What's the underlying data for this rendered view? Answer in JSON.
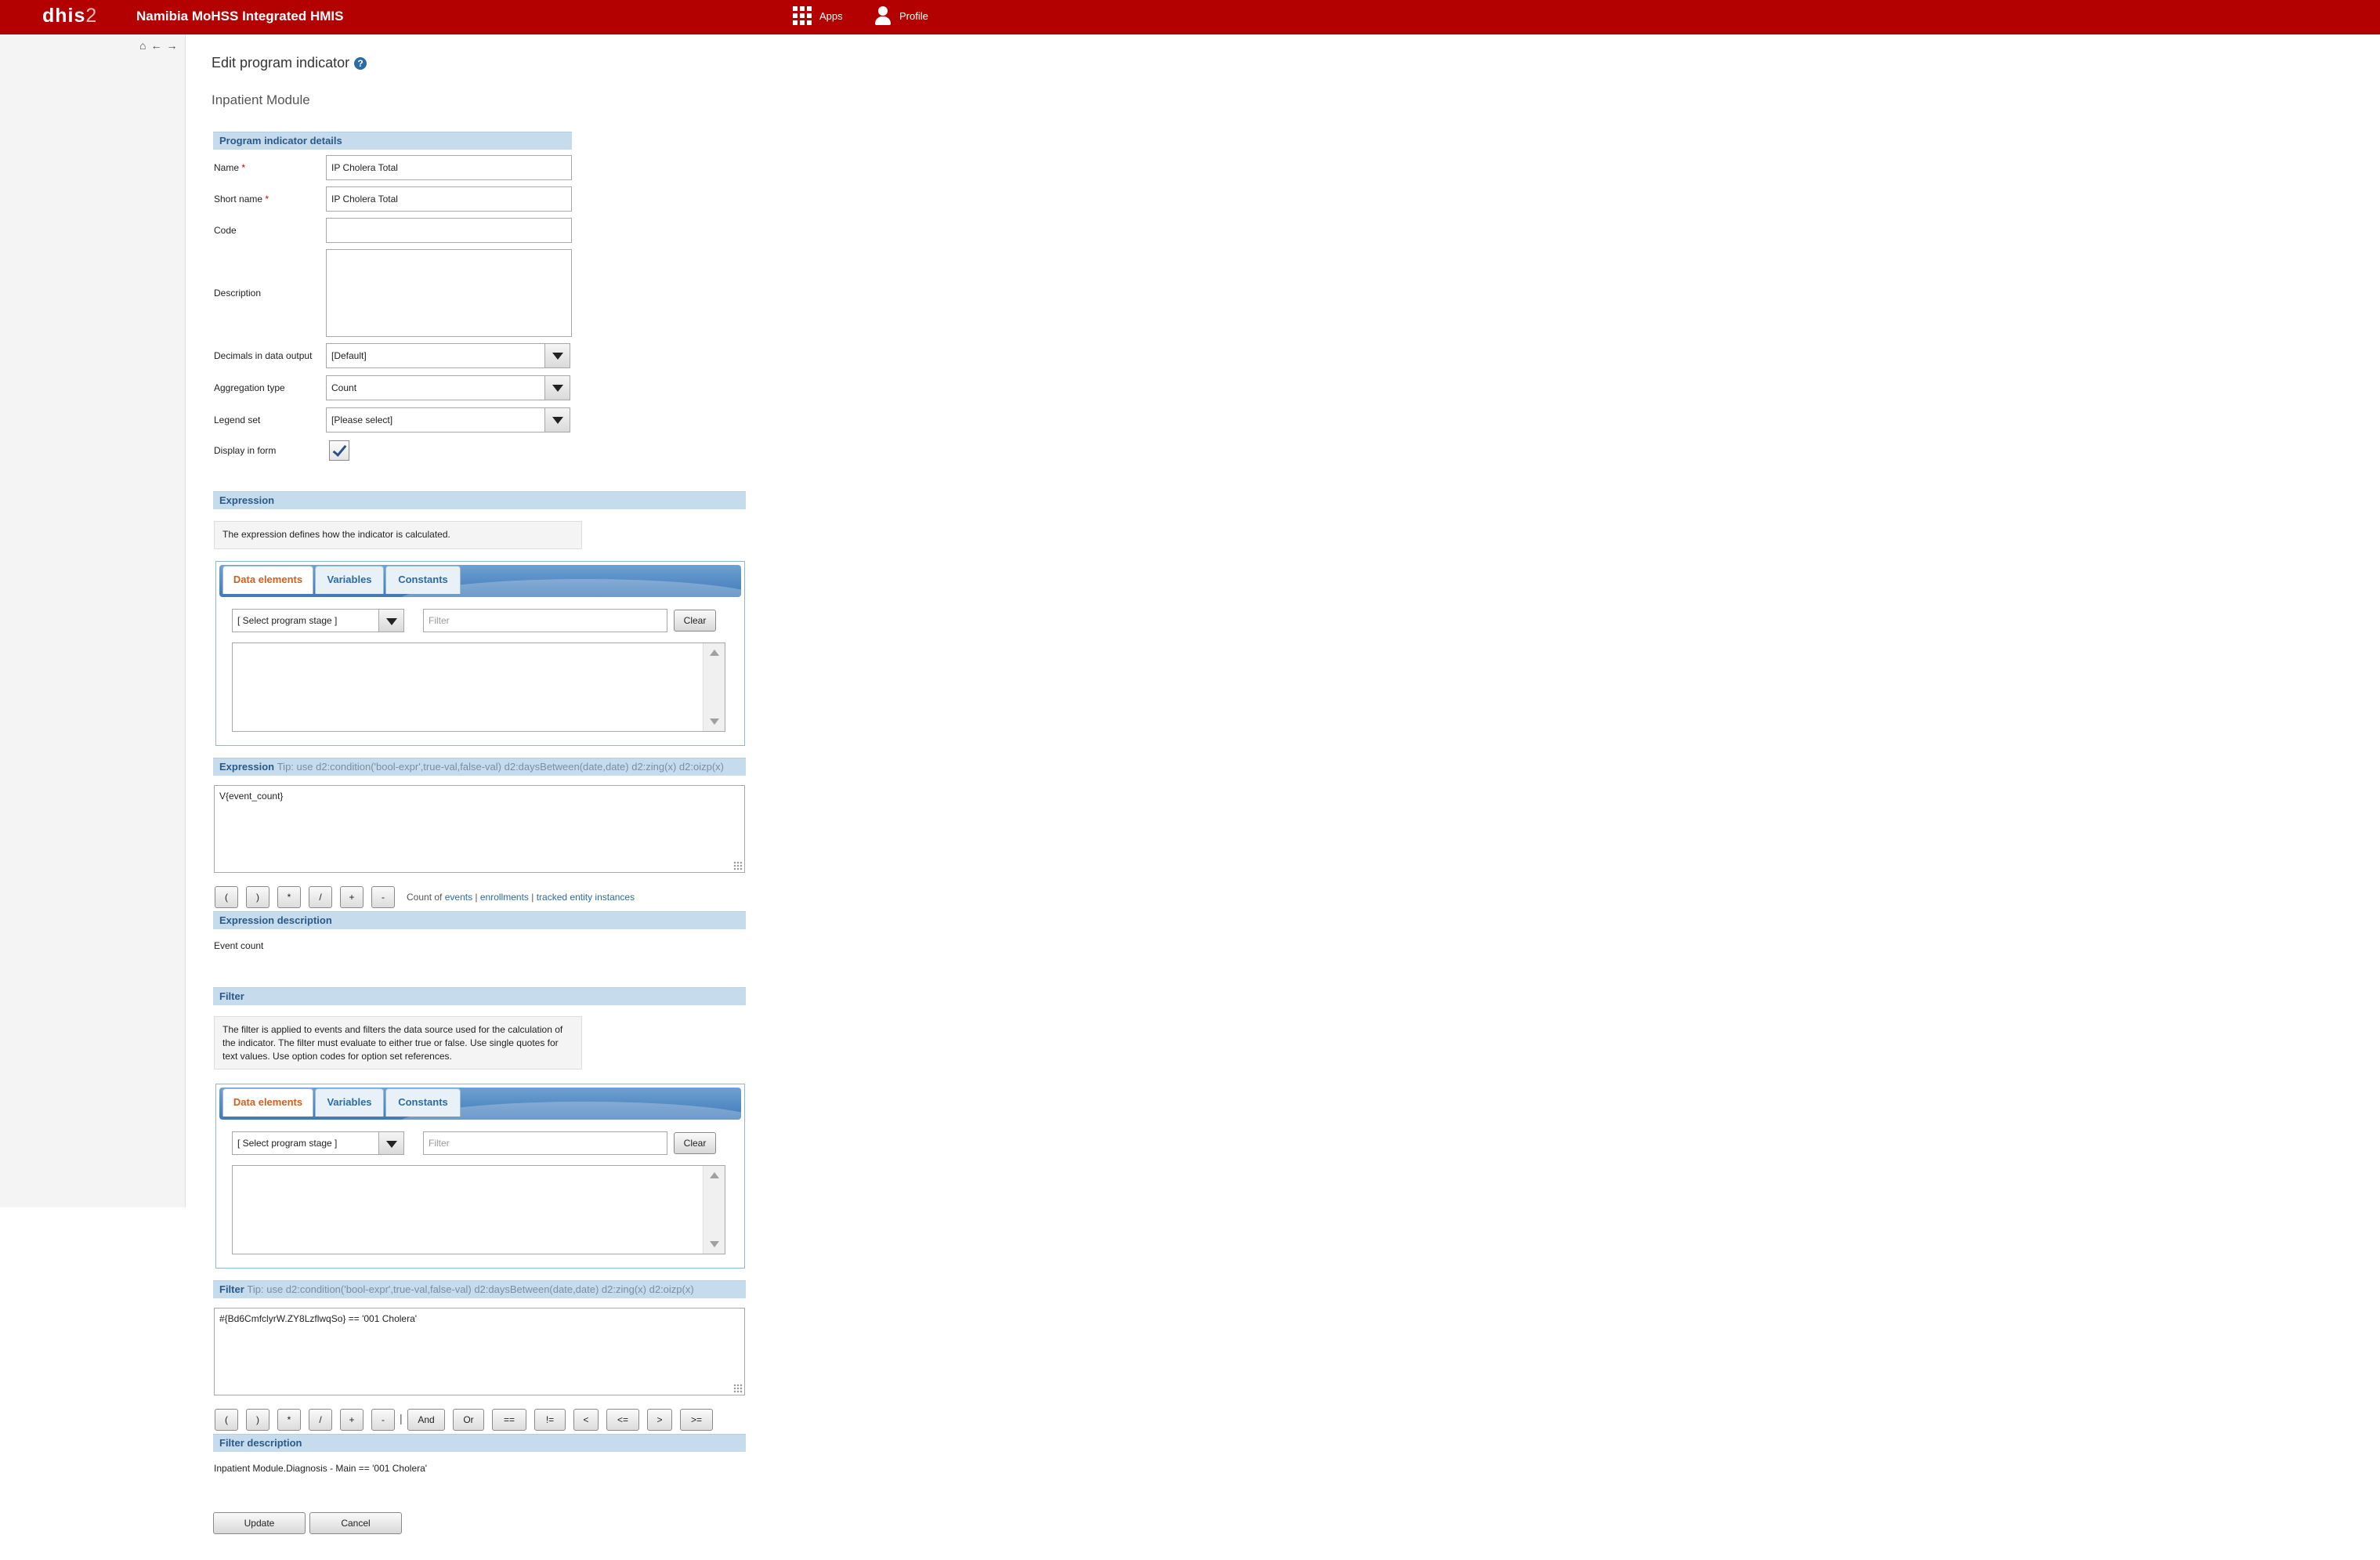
{
  "header": {
    "logo_main": "dhis",
    "logo_num": "2",
    "site_title": "Namibia MoHSS Integrated HMIS",
    "apps_label": "Apps",
    "profile_label": "Profile"
  },
  "page": {
    "title": "Edit program indicator",
    "subtitle": "Inpatient Module"
  },
  "details": {
    "header": "Program indicator details",
    "name_label": "Name",
    "name_value": "IP Cholera Total",
    "short_name_label": "Short name",
    "short_name_value": "IP Cholera Total",
    "code_label": "Code",
    "code_value": "",
    "description_label": "Description",
    "description_value": "",
    "decimals_label": "Decimals in data output",
    "decimals_value": "[Default]",
    "aggregation_label": "Aggregation type",
    "aggregation_value": "Count",
    "legend_label": "Legend set",
    "legend_value": "[Please select]",
    "display_label": "Display in form",
    "display_checked": true
  },
  "expression": {
    "header": "Expression",
    "info": "The expression defines how the indicator is calculated.",
    "tabs": [
      "Data elements",
      "Variables",
      "Constants"
    ],
    "stage_select": "[ Select program stage ]",
    "filter_placeholder": "Filter",
    "clear_label": "Clear",
    "editor_header": "Expression",
    "editor_tip": "Tip: use d2:condition('bool-expr',true-val,false-val) d2:daysBetween(date,date) d2:zing(x) d2:oizp(x)",
    "editor_value": "V{event_count}",
    "operators": [
      "(",
      ")",
      "*",
      "/",
      "+",
      "-"
    ],
    "count_of": "Count of",
    "count_links": [
      "events",
      "enrollments",
      "tracked entity instances"
    ],
    "description_header": "Expression description",
    "description_value": "Event count"
  },
  "filter": {
    "header": "Filter",
    "info": "The filter is applied to events and filters the data source used for the calculation of the indicator. The filter must evaluate to either true or false. Use single quotes for text values. Use option codes for option set references.",
    "tabs": [
      "Data elements",
      "Variables",
      "Constants"
    ],
    "stage_select": "[ Select program stage ]",
    "filter_placeholder": "Filter",
    "clear_label": "Clear",
    "editor_header": "Filter",
    "editor_tip": "Tip: use d2:condition('bool-expr',true-val,false-val) d2:daysBetween(date,date) d2:zing(x) d2:oizp(x)",
    "editor_value": "#{Bd6CmfclyrW.ZY8LzflwqSo} == '001 Cholera'",
    "operators": [
      "(",
      ")",
      "*",
      "/",
      "+",
      "-"
    ],
    "pipe": "|",
    "logic_operators": [
      "And",
      "Or",
      "==",
      "!=",
      "<",
      "<=",
      ">",
      ">="
    ],
    "description_header": "Filter description",
    "description_value": "Inpatient Module.Diagnosis - Main == '001 Cholera'"
  },
  "actions": {
    "update_label": "Update",
    "cancel_label": "Cancel"
  }
}
